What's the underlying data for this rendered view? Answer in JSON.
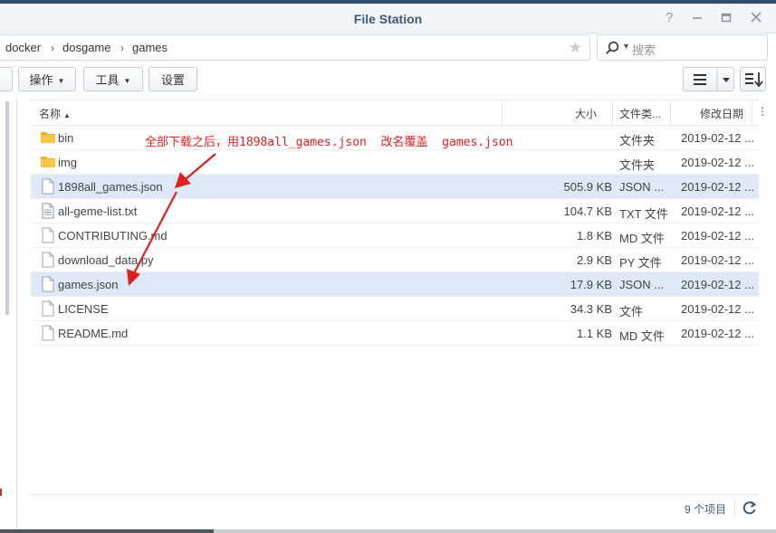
{
  "window": {
    "title": "File Station",
    "help_symbol": "?"
  },
  "breadcrumb": [
    "docker",
    "dosgame",
    "games"
  ],
  "search": {
    "placeholder": "搜索"
  },
  "toolbar": {
    "action_label": "操作",
    "tools_label": "工具",
    "settings_label": "设置"
  },
  "columns": {
    "name": "名称",
    "size": "大小",
    "type": "文件类...",
    "modified": "修改日期"
  },
  "files": [
    {
      "name": "bin",
      "size": "",
      "type": "文件夹",
      "modified": "2019-02-12 ...",
      "icon": "folder-icon",
      "selected": false
    },
    {
      "name": "img",
      "size": "",
      "type": "文件夹",
      "modified": "2019-02-12 ...",
      "icon": "folder-icon",
      "selected": false
    },
    {
      "name": "1898all_games.json",
      "size": "505.9 KB",
      "type": "JSON ...",
      "modified": "2019-02-12 ...",
      "icon": "file-icon",
      "selected": true
    },
    {
      "name": "all-geme-list.txt",
      "size": "104.7 KB",
      "type": "TXT 文件",
      "modified": "2019-02-12 ...",
      "icon": "text-file-icon",
      "selected": false
    },
    {
      "name": "CONTRIBUTING.md",
      "size": "1.8 KB",
      "type": "MD 文件",
      "modified": "2019-02-12 ...",
      "icon": "file-icon",
      "selected": false
    },
    {
      "name": "download_data.py",
      "size": "2.9 KB",
      "type": "PY 文件",
      "modified": "2019-02-12 ...",
      "icon": "file-icon",
      "selected": false
    },
    {
      "name": "games.json",
      "size": "17.9 KB",
      "type": "JSON ...",
      "modified": "2019-02-12 ...",
      "icon": "file-icon",
      "selected": true
    },
    {
      "name": "LICENSE",
      "size": "34.3 KB",
      "type": "文件",
      "modified": "2019-02-12 ...",
      "icon": "file-icon",
      "selected": false
    },
    {
      "name": "README.md",
      "size": "1.1 KB",
      "type": "MD 文件",
      "modified": "2019-02-12 ...",
      "icon": "file-icon",
      "selected": false
    }
  ],
  "footer": {
    "item_count": "9 个项目"
  },
  "annotation": {
    "text": "全部下载之后，用1898all_games.json  改名覆盖  games.json",
    "color": "#e02020"
  },
  "colors": {
    "title": "#3d5a7a",
    "selected_row": "#dde9f7",
    "folder": "#f5b324"
  }
}
